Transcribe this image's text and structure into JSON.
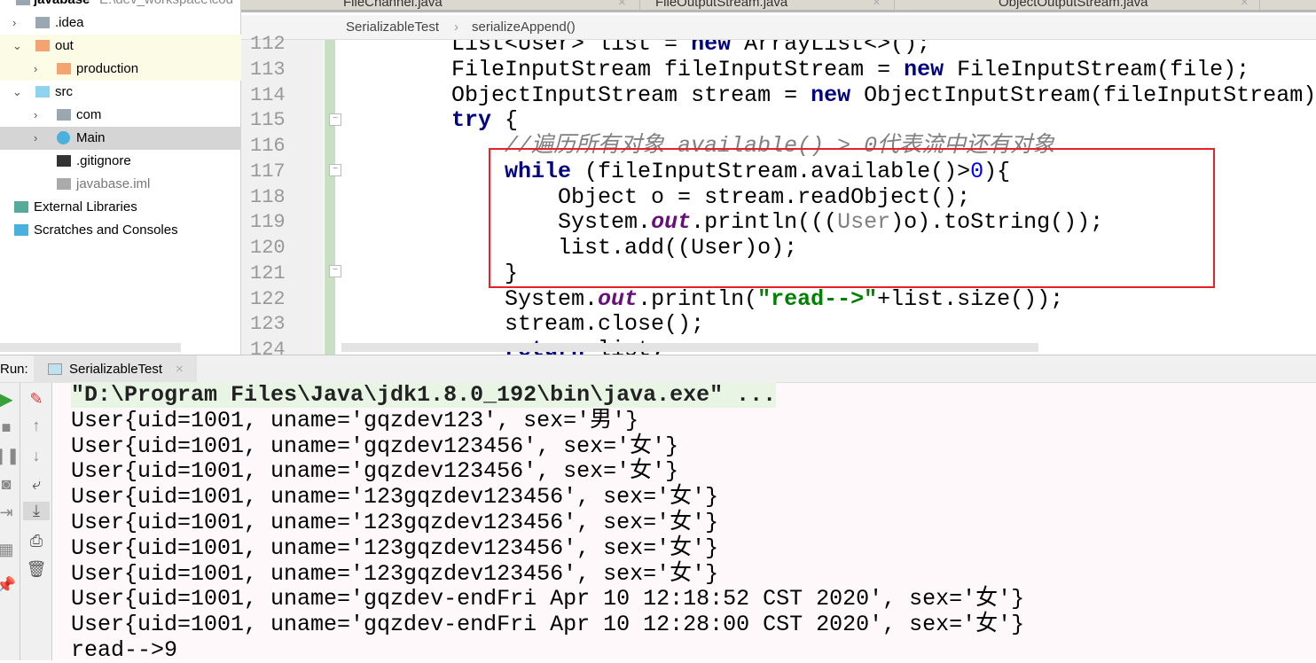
{
  "project_tree": {
    "root": {
      "label": "javabase",
      "path": "E:\\dev_workspace\\cod"
    },
    "items": [
      {
        "label": ".idea",
        "icon": "folder-icon",
        "expanded": false
      },
      {
        "label": "out",
        "icon": "folder-orange-icon",
        "expanded": true
      },
      {
        "label": "production",
        "icon": "folder-orange-icon",
        "expanded": false
      },
      {
        "label": "src",
        "icon": "folder-blue-icon",
        "expanded": true
      },
      {
        "label": "com",
        "icon": "package-icon",
        "expanded": false
      },
      {
        "label": "Main",
        "icon": "java-class-icon",
        "expanded": false,
        "selected": true
      },
      {
        "label": ".gitignore",
        "icon": "git-icon"
      },
      {
        "label": "javabase.iml",
        "icon": "iml-file-icon"
      },
      {
        "label": "External Libraries",
        "icon": "libraries-icon"
      },
      {
        "label": "Scratches and Consoles",
        "icon": "scratches-icon"
      }
    ]
  },
  "editor_tabs": [
    {
      "label": "FileChannel.java"
    },
    {
      "label": "FileOutputStream.java"
    },
    {
      "label": "ObjectOutputStream.java"
    }
  ],
  "breadcrumb": {
    "class": "SerializableTest",
    "separator": "›",
    "method": "serializeAppend()"
  },
  "code_lines": [
    {
      "n": "112",
      "tokens": [
        {
          "t": "        List<User> list = "
        },
        {
          "t": "new",
          "k": "kw"
        },
        {
          "t": " ArrayList<>();"
        }
      ]
    },
    {
      "n": "113",
      "tokens": [
        {
          "t": "        FileInputStream fileInputStream = "
        },
        {
          "t": "new",
          "k": "kw"
        },
        {
          "t": " FileInputStream(file);"
        }
      ]
    },
    {
      "n": "114",
      "tokens": [
        {
          "t": "        ObjectInputStream stream = "
        },
        {
          "t": "new",
          "k": "kw"
        },
        {
          "t": " ObjectInputStream(fileInputStream);"
        }
      ]
    },
    {
      "n": "115",
      "tokens": [
        {
          "t": "        "
        },
        {
          "t": "try",
          "k": "kw"
        },
        {
          "t": " {"
        }
      ]
    },
    {
      "n": "116",
      "tokens": [
        {
          "t": "            "
        },
        {
          "t": "//遍历所有对象 available() > 0代表流中还有对象",
          "k": "cm"
        }
      ]
    },
    {
      "n": "117",
      "tokens": [
        {
          "t": "            "
        },
        {
          "t": "while",
          "k": "kw"
        },
        {
          "t": " (fileInputStream.available()>"
        },
        {
          "t": "0",
          "k": "nm"
        },
        {
          "t": "){"
        }
      ]
    },
    {
      "n": "118",
      "tokens": [
        {
          "t": "                Object o = stream.readObject();"
        }
      ]
    },
    {
      "n": "119",
      "tokens": [
        {
          "t": "                System."
        },
        {
          "t": "out",
          "k": "fi"
        },
        {
          "t": ".println((("
        },
        {
          "t": "User",
          "k": "un"
        },
        {
          "t": ")o).toString());"
        }
      ]
    },
    {
      "n": "120",
      "tokens": [
        {
          "t": "                list.add((User)o);"
        }
      ]
    },
    {
      "n": "121",
      "tokens": [
        {
          "t": "            }"
        }
      ]
    },
    {
      "n": "122",
      "tokens": [
        {
          "t": "            System."
        },
        {
          "t": "out",
          "k": "fi"
        },
        {
          "t": ".println("
        },
        {
          "t": "\"read-->\"",
          "k": "st"
        },
        {
          "t": "+list.size());"
        }
      ]
    },
    {
      "n": "123",
      "tokens": [
        {
          "t": "            stream.close();"
        }
      ]
    },
    {
      "n": "124",
      "tokens": [
        {
          "t": "            "
        },
        {
          "t": "return",
          "k": "kw"
        },
        {
          "t": " list;"
        }
      ]
    }
  ],
  "highlight_color": "#e8202a",
  "run_panel": {
    "label": "Run:",
    "tab": "SerializableTest",
    "close": "×"
  },
  "console_lines": [
    "\"D:\\Program Files\\Java\\jdk1.8.0_192\\bin\\java.exe\" ...",
    "User{uid=1001, uname='gqzdev123', sex='男'}",
    "User{uid=1001, uname='gqzdev123456', sex='女'}",
    "User{uid=1001, uname='gqzdev123456', sex='女'}",
    "User{uid=1001, uname='123gqzdev123456', sex='女'}",
    "User{uid=1001, uname='123gqzdev123456', sex='女'}",
    "User{uid=1001, uname='123gqzdev123456', sex='女'}",
    "User{uid=1001, uname='123gqzdev123456', sex='女'}",
    "User{uid=1001, uname='gqzdev-endFri Apr 10 12:18:52 CST 2020', sex='女'}",
    "User{uid=1001, uname='gqzdev-endFri Apr 10 12:28:00 CST 2020', sex='女'}",
    "read-->9"
  ]
}
